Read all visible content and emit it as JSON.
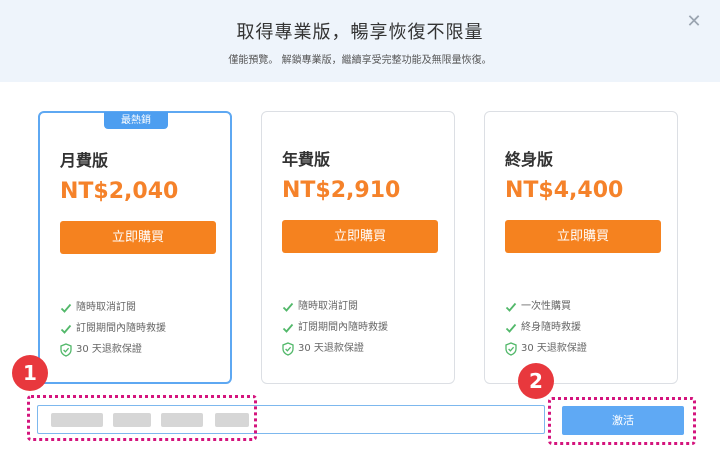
{
  "header": {
    "title": "取得專業版，暢享恢復不限量",
    "subtitle": "僅能預覽。 解鎖專業版，繼續享受完整功能及無限量恢復。",
    "close_icon": "close-icon"
  },
  "plans": [
    {
      "badge": "最熱銷",
      "name": "月費版",
      "price": "NT$2,040",
      "buy_label": "立即購買",
      "features": [
        "隨時取消訂閱",
        "訂閱期間內隨時救援",
        "30 天退款保證"
      ]
    },
    {
      "name": "年費版",
      "price": "NT$2,910",
      "buy_label": "立即購買",
      "features": [
        "隨時取消訂閱",
        "訂閱期間內隨時救援",
        "30 天退款保證"
      ]
    },
    {
      "name": "終身版",
      "price": "NT$4,400",
      "buy_label": "立即購買",
      "features": [
        "一次性購買",
        "終身隨時救援",
        "30 天退款保證"
      ]
    }
  ],
  "activation": {
    "key_value": "",
    "button_label": "激活"
  },
  "annotations": {
    "marker_1": "1",
    "marker_2": "2"
  },
  "colors": {
    "accent_orange": "#f5821f",
    "accent_blue": "#5fa9f4",
    "check_green": "#52b86a",
    "annotation_pink": "#d4147d",
    "marker_red": "#e8383d"
  }
}
